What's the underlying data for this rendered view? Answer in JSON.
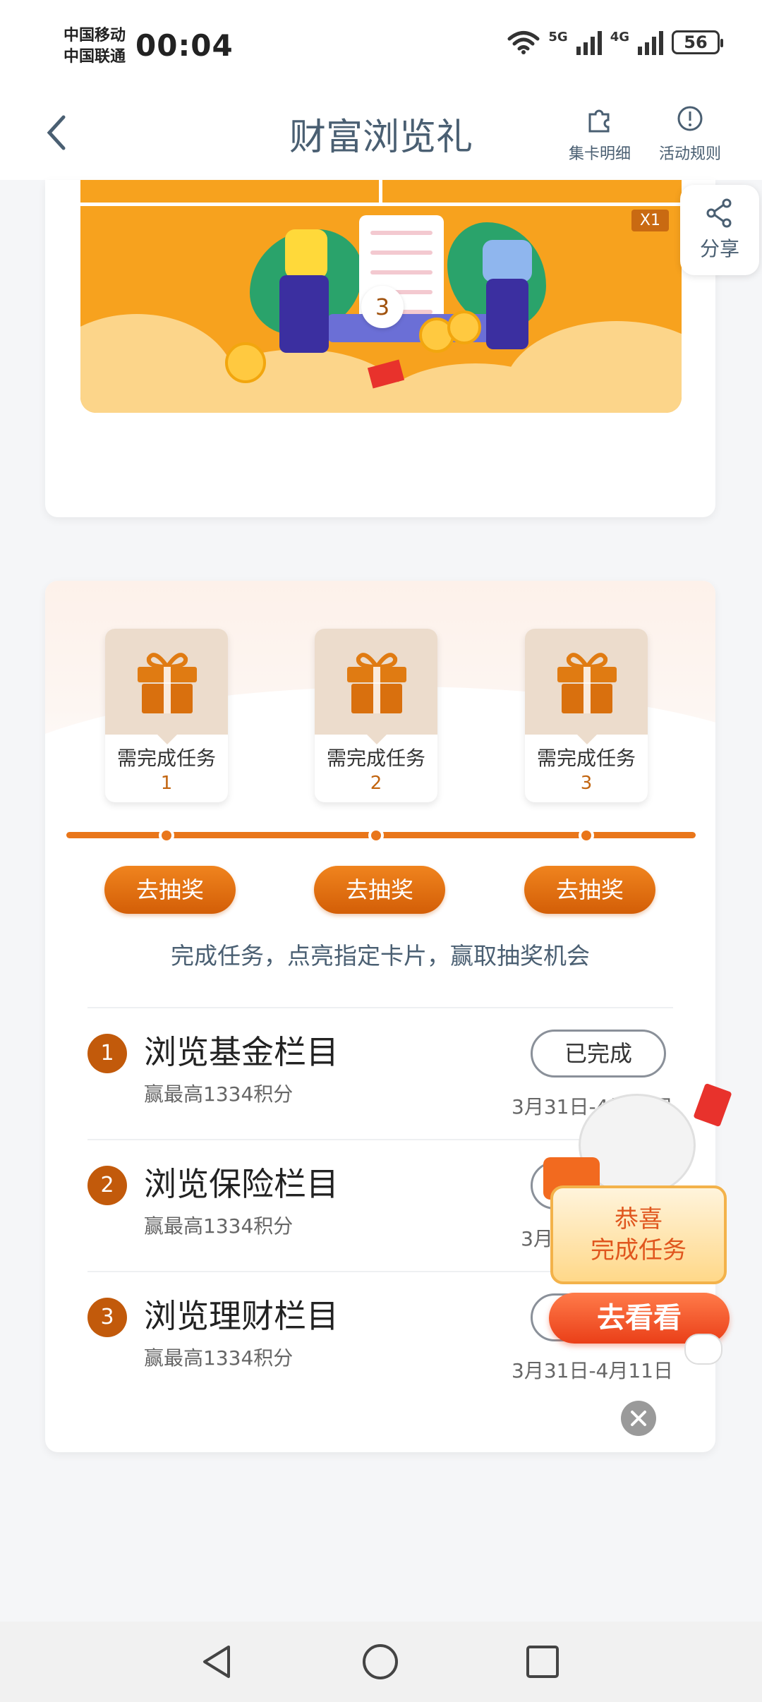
{
  "status_bar": {
    "carrier_1": "中国移动",
    "carrier_2": "中国联通",
    "time": "00:04",
    "net_1": "5G",
    "net_2": "4G",
    "battery": "56"
  },
  "nav": {
    "title": "财富浏览礼",
    "card_detail_label": "集卡明细",
    "rules_label": "活动规则"
  },
  "share": {
    "label": "分享"
  },
  "banner": {
    "multiplier": "X1",
    "card_number": "3"
  },
  "gifts": [
    {
      "label": "需完成任务",
      "count": "1"
    },
    {
      "label": "需完成任务",
      "count": "2"
    },
    {
      "label": "需完成任务",
      "count": "3"
    }
  ],
  "draw_buttons": [
    "去抽奖",
    "去抽奖",
    "去抽奖"
  ],
  "hint": "完成任务，点亮指定卡片，赢取抽奖机会",
  "tasks": [
    {
      "no": "1",
      "title": "浏览基金栏目",
      "sub": "赢最高1334积分",
      "button": "已完成",
      "date": "3月31日-4月11日"
    },
    {
      "no": "2",
      "title": "浏览保险栏目",
      "sub": "赢最高1334积分",
      "button": "",
      "date": "3月"
    },
    {
      "no": "3",
      "title": "浏览理财栏目",
      "sub": "赢最高1334积分",
      "button": "",
      "date": "3月31日-4月11日"
    }
  ],
  "promo": {
    "line1": "恭喜",
    "line2": "完成任务",
    "cta": "去看看"
  },
  "colors": {
    "accent": "#e9761a",
    "title": "#4a5f72",
    "task_badge": "#c25a0b",
    "promo": "#ea3f18"
  }
}
